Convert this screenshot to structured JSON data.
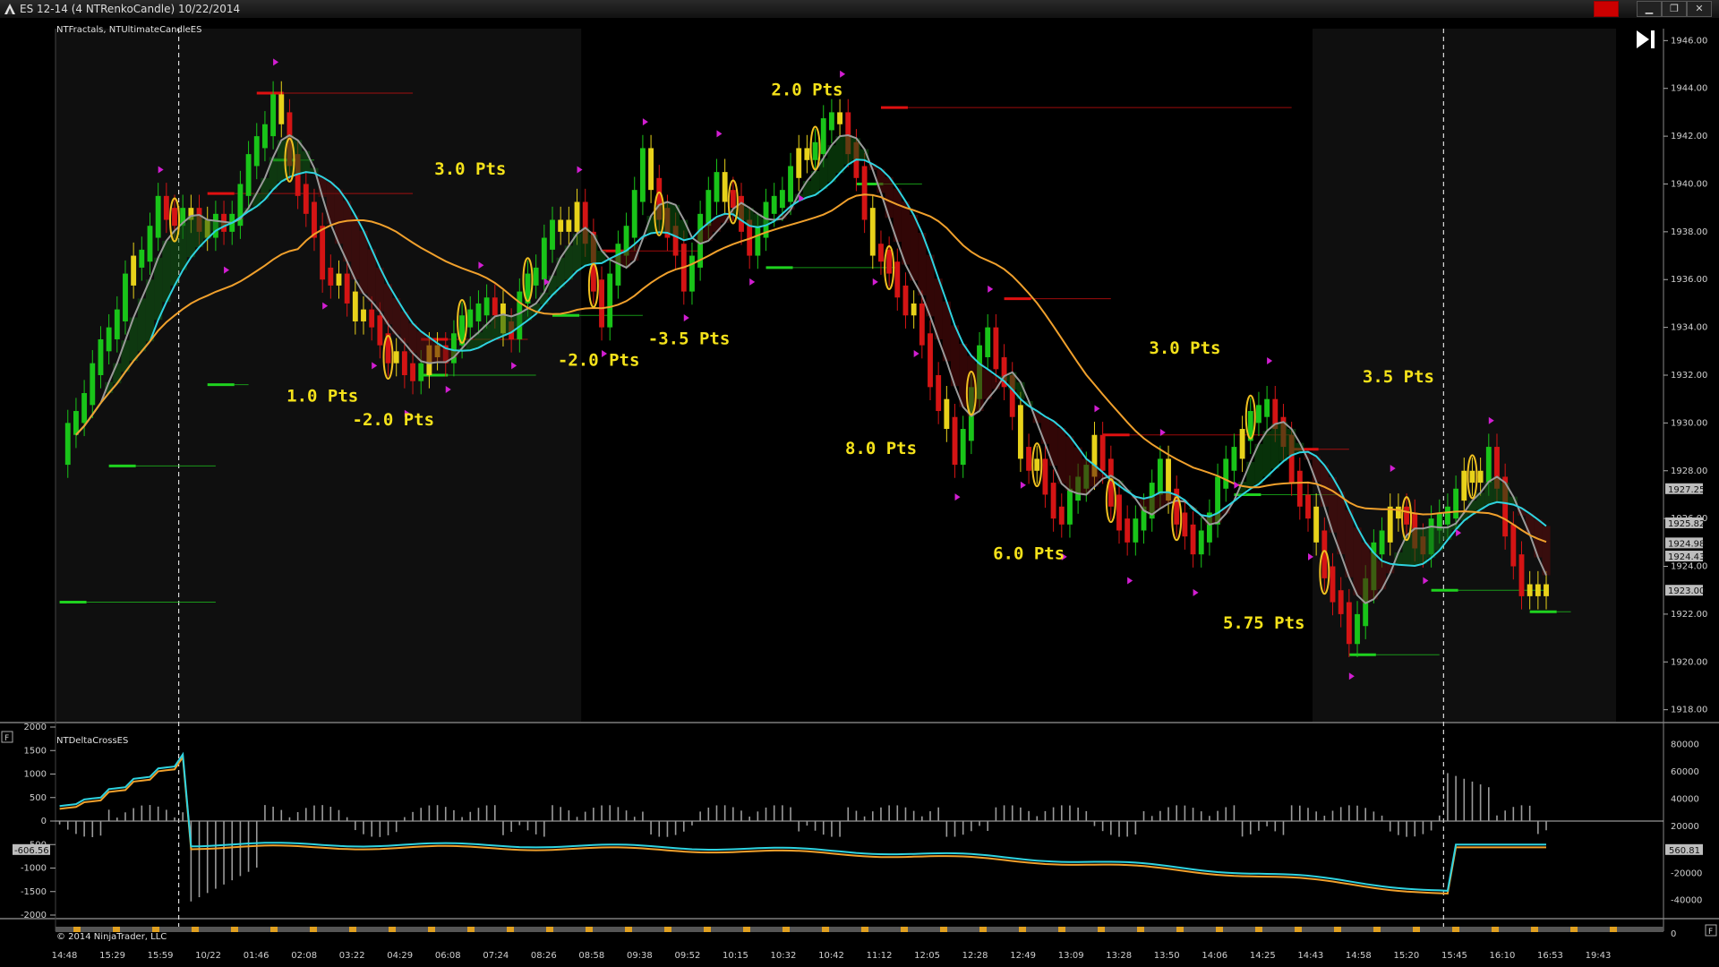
{
  "window": {
    "title": "ES 12-14 (4 NTRenkoCandle)  10/22/2014",
    "buttons": [
      "minimize",
      "restore",
      "close"
    ]
  },
  "main_panel": {
    "indicators_label": "NTFractals, NTUltimateCandleES",
    "price_ticks": [
      "1946.00",
      "1944.00",
      "1942.00",
      "1940.00",
      "1938.00",
      "1936.00",
      "1934.00",
      "1932.00",
      "1930.00",
      "1928.00",
      "1926.00",
      "1924.00",
      "1922.00",
      "1920.00",
      "1918.00"
    ],
    "price_tags": [
      {
        "text": "1927.25",
        "price": 1927.25
      },
      {
        "text": "1925.82",
        "price": 1925.82
      },
      {
        "text": "1924.98",
        "price": 1924.98
      },
      {
        "text": "1924.43",
        "price": 1924.43
      },
      {
        "text": "1923.00",
        "price": 1923.0
      }
    ],
    "annotations": [
      {
        "text": "1.0  Pts",
        "bar": 32,
        "price": 1930.9
      },
      {
        "text": "-2.0  Pts",
        "bar": 40,
        "price": 1929.9
      },
      {
        "text": "3.0  Pts",
        "bar": 50,
        "price": 1940.4
      },
      {
        "text": "-2.0  Pts",
        "bar": 65,
        "price": 1932.4
      },
      {
        "text": "-3.5  Pts",
        "bar": 76,
        "price": 1933.3
      },
      {
        "text": "2.0  Pts",
        "bar": 91,
        "price": 1943.7
      },
      {
        "text": "8.0  Pts",
        "bar": 100,
        "price": 1928.7
      },
      {
        "text": "6.0  Pts",
        "bar": 118,
        "price": 1924.3
      },
      {
        "text": "3.0  Pts",
        "bar": 137,
        "price": 1932.9
      },
      {
        "text": "5.75  Pts",
        "bar": 146,
        "price": 1921.4
      },
      {
        "text": "3.5  Pts",
        "bar": 163,
        "price": 1931.7
      }
    ]
  },
  "sub_panel": {
    "label": "NTDeltaCrossES",
    "left_ticks": [
      "2000",
      "1500",
      "1000",
      "500",
      "0",
      "-500",
      "-1000",
      "-1500",
      "-2000"
    ],
    "right_ticks": [
      "80000",
      "60000",
      "40000",
      "20000",
      "-20000",
      "-40000",
      "0"
    ],
    "left_tag": "-606.56",
    "right_tag": "560.81"
  },
  "time_axis": [
    "14:48",
    "15:29",
    "15:59",
    "10/22",
    "01:46",
    "02:08",
    "03:22",
    "04:29",
    "06:08",
    "07:24",
    "08:26",
    "08:58",
    "09:38",
    "09:52",
    "10:15",
    "10:32",
    "10:42",
    "11:12",
    "12:05",
    "12:28",
    "12:49",
    "13:09",
    "13:28",
    "13:50",
    "14:06",
    "14:25",
    "14:43",
    "14:58",
    "15:20",
    "15:45",
    "16:10",
    "16:53",
    "19:43"
  ],
  "copyright": "© 2014 NinjaTrader, LLC",
  "chart_data": {
    "type": "candlestick",
    "price_range": [
      1917.5,
      1946.5
    ],
    "close_path": [
      {
        "bar": 0,
        "price": 1928.5
      },
      {
        "bar": 6,
        "price": 1934.0
      },
      {
        "bar": 12,
        "price": 1939.0
      },
      {
        "bar": 20,
        "price": 1938.0
      },
      {
        "bar": 26,
        "price": 1943.5
      },
      {
        "bar": 32,
        "price": 1936.5
      },
      {
        "bar": 38,
        "price": 1934.0
      },
      {
        "bar": 42,
        "price": 1932.0
      },
      {
        "bar": 47,
        "price": 1933.0
      },
      {
        "bar": 51,
        "price": 1935.0
      },
      {
        "bar": 55,
        "price": 1934.0
      },
      {
        "bar": 59,
        "price": 1937.5
      },
      {
        "bar": 63,
        "price": 1939.0
      },
      {
        "bar": 66,
        "price": 1934.5
      },
      {
        "bar": 71,
        "price": 1941.0
      },
      {
        "bar": 76,
        "price": 1936.0
      },
      {
        "bar": 80,
        "price": 1940.5
      },
      {
        "bar": 84,
        "price": 1937.5
      },
      {
        "bar": 90,
        "price": 1941.0
      },
      {
        "bar": 95,
        "price": 1943.0
      },
      {
        "bar": 99,
        "price": 1937.5
      },
      {
        "bar": 104,
        "price": 1934.5
      },
      {
        "bar": 109,
        "price": 1928.5
      },
      {
        "bar": 113,
        "price": 1934.0
      },
      {
        "bar": 117,
        "price": 1929.0
      },
      {
        "bar": 122,
        "price": 1926.0
      },
      {
        "bar": 126,
        "price": 1929.0
      },
      {
        "bar": 130,
        "price": 1925.0
      },
      {
        "bar": 134,
        "price": 1928.0
      },
      {
        "bar": 138,
        "price": 1924.5
      },
      {
        "bar": 143,
        "price": 1929.0
      },
      {
        "bar": 147,
        "price": 1931.0
      },
      {
        "bar": 152,
        "price": 1926.0
      },
      {
        "bar": 157,
        "price": 1921.0
      },
      {
        "bar": 162,
        "price": 1926.5
      },
      {
        "bar": 166,
        "price": 1925.0
      },
      {
        "bar": 170,
        "price": 1927.0
      },
      {
        "bar": 174,
        "price": 1928.5
      },
      {
        "bar": 178,
        "price": 1923.0
      }
    ],
    "moving_averages": [
      {
        "color": "#9a9a9a",
        "period": 6
      },
      {
        "color": "#2fd3e0",
        "period": 12
      },
      {
        "color": "#f0a02c",
        "period": 30
      }
    ],
    "fractal_levels": [
      {
        "type": "high",
        "price": 1943.8,
        "from": 24,
        "to": 43
      },
      {
        "type": "high",
        "price": 1939.6,
        "from": 18,
        "to": 43
      },
      {
        "type": "low",
        "price": 1941.0,
        "from": 26,
        "to": 31
      },
      {
        "type": "low",
        "price": 1931.6,
        "from": 18,
        "to": 23
      },
      {
        "type": "low",
        "price": 1928.2,
        "from": 6,
        "to": 19
      },
      {
        "type": "low",
        "price": 1922.5,
        "from": 0,
        "to": 19
      },
      {
        "type": "high",
        "price": 1933.5,
        "from": 44,
        "to": 57
      },
      {
        "type": "low",
        "price": 1932.0,
        "from": 44,
        "to": 58
      },
      {
        "type": "high",
        "price": 1937.2,
        "from": 66,
        "to": 78
      },
      {
        "type": "low",
        "price": 1934.5,
        "from": 60,
        "to": 71
      },
      {
        "type": "low",
        "price": 1936.5,
        "from": 86,
        "to": 102
      },
      {
        "type": "high",
        "price": 1943.2,
        "from": 100,
        "to": 150
      },
      {
        "type": "low",
        "price": 1940.0,
        "from": 97,
        "to": 105
      },
      {
        "type": "high",
        "price": 1935.2,
        "from": 115,
        "to": 128
      },
      {
        "type": "high",
        "price": 1929.5,
        "from": 127,
        "to": 150
      },
      {
        "type": "low",
        "price": 1927.0,
        "from": 143,
        "to": 156
      },
      {
        "type": "high",
        "price": 1928.9,
        "from": 150,
        "to": 157
      },
      {
        "type": "low",
        "price": 1920.3,
        "from": 157,
        "to": 168
      },
      {
        "type": "low",
        "price": 1923.0,
        "from": 167,
        "to": 181
      },
      {
        "type": "low",
        "price": 1922.1,
        "from": 179,
        "to": 184
      }
    ],
    "delta_cross": {
      "before_session": [
        400,
        500,
        700,
        900,
        1100,
        1400
      ],
      "session_level": -500,
      "session_end_level": -1500,
      "after_level": -500
    }
  }
}
